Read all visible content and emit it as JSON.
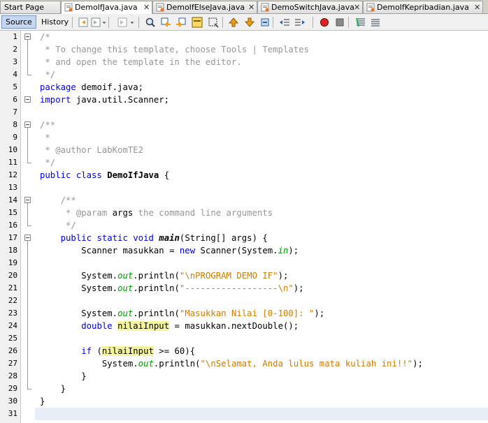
{
  "tabs": [
    {
      "label": "Start Page",
      "active": false,
      "has_icon": false,
      "closable": false
    },
    {
      "label": "DemoIfJava.java",
      "active": true,
      "has_icon": true,
      "closable": true
    },
    {
      "label": "DemoIfElseJava.java",
      "active": false,
      "has_icon": true,
      "closable": true
    },
    {
      "label": "DemoSwitchJava.java",
      "active": false,
      "has_icon": true,
      "closable": true
    },
    {
      "label": "DemoIfKepribadian.java",
      "active": false,
      "has_icon": true,
      "closable": true
    }
  ],
  "close_glyph": "✕",
  "toolbar": {
    "source_label": "Source",
    "history_label": "History",
    "icons": [
      "back-icon",
      "forward-history-icon",
      "dropdown-icon",
      "forward-icon",
      "dropdown-icon",
      "find-icon",
      "find-previous-icon",
      "find-next-icon",
      "toggle-highlight-icon",
      "toggle-rect-select-icon",
      "previous-bookmark-icon",
      "next-bookmark-icon",
      "toggle-bookmark-icon",
      "shift-left-icon",
      "shift-right-icon",
      "start-macro-icon",
      "stop-macro-icon",
      "comment-icon",
      "uncomment-icon"
    ]
  },
  "editor": {
    "current_line": 31,
    "lines": [
      {
        "n": "1",
        "segs": [
          {
            "t": "/*",
            "c": "cmt"
          }
        ]
      },
      {
        "n": "2",
        "segs": [
          {
            "t": " * To change this template, choose Tools | Templates",
            "c": "cmt"
          }
        ]
      },
      {
        "n": "3",
        "segs": [
          {
            "t": " * and open the template in the editor.",
            "c": "cmt"
          }
        ]
      },
      {
        "n": "4",
        "segs": [
          {
            "t": " */",
            "c": "cmt"
          }
        ]
      },
      {
        "n": "5",
        "segs": [
          {
            "t": "package",
            "c": "kw"
          },
          {
            "t": " demoif.java;"
          }
        ]
      },
      {
        "n": "6",
        "segs": [
          {
            "t": "import",
            "c": "kw"
          },
          {
            "t": " java.util.Scanner;"
          }
        ]
      },
      {
        "n": "7",
        "segs": []
      },
      {
        "n": "8",
        "segs": [
          {
            "t": "/**",
            "c": "cmt"
          }
        ]
      },
      {
        "n": "9",
        "segs": [
          {
            "t": " *",
            "c": "cmt"
          }
        ]
      },
      {
        "n": "10",
        "segs": [
          {
            "t": " * @author LabKomTE2",
            "c": "cmt"
          }
        ]
      },
      {
        "n": "11",
        "segs": [
          {
            "t": " */",
            "c": "cmt"
          }
        ]
      },
      {
        "n": "12",
        "segs": [
          {
            "t": "public class",
            "c": "kw"
          },
          {
            "t": " "
          },
          {
            "t": "DemoIfJava",
            "c": "bold"
          },
          {
            "t": " {"
          }
        ]
      },
      {
        "n": "13",
        "segs": []
      },
      {
        "n": "14",
        "segs": [
          {
            "t": "    /**",
            "c": "cmt"
          }
        ]
      },
      {
        "n": "15",
        "segs": [
          {
            "t": "     * @param ",
            "c": "cmt"
          },
          {
            "t": "args"
          },
          {
            "t": " the command line arguments",
            "c": "cmt"
          }
        ]
      },
      {
        "n": "16",
        "segs": [
          {
            "t": "     */",
            "c": "cmt"
          }
        ]
      },
      {
        "n": "17",
        "segs": [
          {
            "t": "    "
          },
          {
            "t": "public static void",
            "c": "kw"
          },
          {
            "t": " "
          },
          {
            "t": "main",
            "c": "mth"
          },
          {
            "t": "(String[] args) {"
          }
        ]
      },
      {
        "n": "18",
        "segs": [
          {
            "t": "        Scanner masukkan = "
          },
          {
            "t": "new",
            "c": "kw"
          },
          {
            "t": " Scanner(System."
          },
          {
            "t": "in",
            "c": "fld"
          },
          {
            "t": ");"
          }
        ]
      },
      {
        "n": "19",
        "segs": []
      },
      {
        "n": "20",
        "segs": [
          {
            "t": "        System."
          },
          {
            "t": "out",
            "c": "fld"
          },
          {
            "t": ".println("
          },
          {
            "t": "\"\\nPROGRAM DEMO IF\"",
            "c": "str"
          },
          {
            "t": ");"
          }
        ]
      },
      {
        "n": "21",
        "segs": [
          {
            "t": "        System."
          },
          {
            "t": "out",
            "c": "fld"
          },
          {
            "t": ".println("
          },
          {
            "t": "\"------------------\\n\"",
            "c": "str"
          },
          {
            "t": ");"
          }
        ]
      },
      {
        "n": "22",
        "segs": []
      },
      {
        "n": "23",
        "segs": [
          {
            "t": "        System."
          },
          {
            "t": "out",
            "c": "fld"
          },
          {
            "t": ".println("
          },
          {
            "t": "\"Masukkan Nilai [0-100]: \"",
            "c": "str"
          },
          {
            "t": ");"
          }
        ]
      },
      {
        "n": "24",
        "segs": [
          {
            "t": "        "
          },
          {
            "t": "double",
            "c": "kw"
          },
          {
            "t": " "
          },
          {
            "t": "nilaiInput",
            "c": "hl"
          },
          {
            "t": " = masukkan.nextDouble();"
          }
        ]
      },
      {
        "n": "25",
        "segs": []
      },
      {
        "n": "26",
        "segs": [
          {
            "t": "        "
          },
          {
            "t": "if",
            "c": "kw"
          },
          {
            "t": " ("
          },
          {
            "t": "nilaiInput",
            "c": "hl"
          },
          {
            "t": " >= 60){"
          }
        ]
      },
      {
        "n": "27",
        "segs": [
          {
            "t": "            System."
          },
          {
            "t": "out",
            "c": "fld"
          },
          {
            "t": ".println("
          },
          {
            "t": "\"\\nSelamat, Anda lulus mata kuliah ini!!\"",
            "c": "str"
          },
          {
            "t": ");"
          }
        ]
      },
      {
        "n": "28",
        "segs": [
          {
            "t": "        }"
          }
        ]
      },
      {
        "n": "29",
        "segs": [
          {
            "t": "    }"
          }
        ]
      },
      {
        "n": "30",
        "segs": [
          {
            "t": "}"
          }
        ]
      },
      {
        "n": "31",
        "segs": []
      }
    ],
    "folds": [
      {
        "start": 1,
        "end": 4
      },
      {
        "start": 6,
        "end": 6
      },
      {
        "start": 8,
        "end": 11
      },
      {
        "start": 14,
        "end": 16
      },
      {
        "start": 17,
        "end": 29
      }
    ]
  }
}
